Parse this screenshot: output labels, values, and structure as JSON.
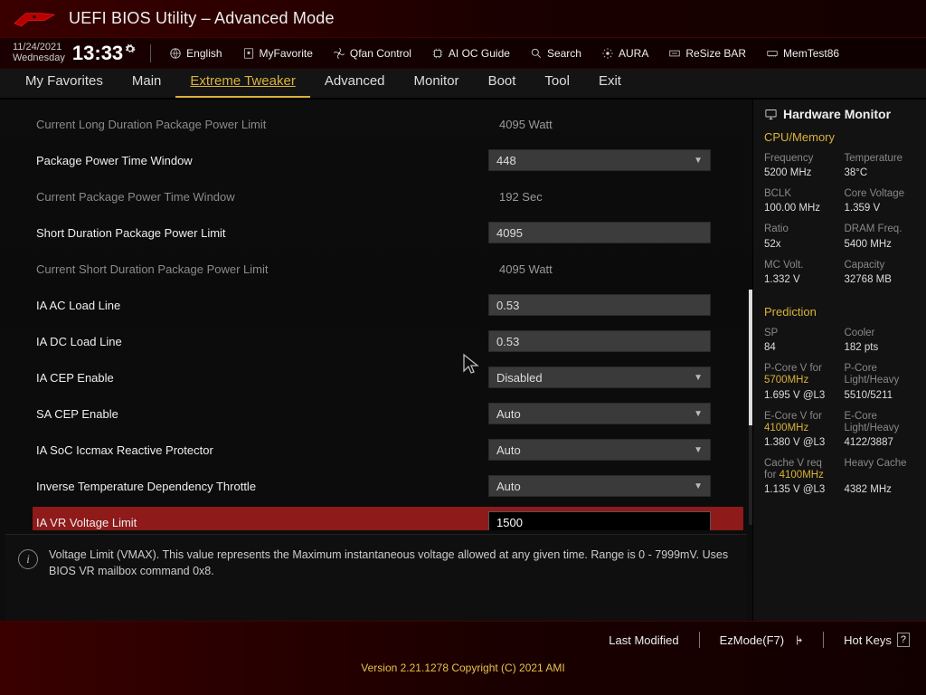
{
  "title": "UEFI BIOS Utility – Advanced Mode",
  "datetime": {
    "date": "11/24/2021",
    "weekday": "Wednesday",
    "clock": "13:33"
  },
  "util_links": {
    "language": "English",
    "myfavorite": "MyFavorite",
    "qfan": "Qfan Control",
    "aioc": "AI OC Guide",
    "search": "Search",
    "aura": "AURA",
    "resizebar": "ReSize BAR",
    "memtest": "MemTest86"
  },
  "tabs": {
    "myfav": "My Favorites",
    "main": "Main",
    "extreme": "Extreme Tweaker",
    "advanced": "Advanced",
    "monitor": "Monitor",
    "boot": "Boot",
    "tool": "Tool",
    "exit": "Exit"
  },
  "settings": [
    {
      "type": "ro",
      "label": "Current Long Duration Package Power Limit",
      "value": "4095 Watt"
    },
    {
      "type": "dd",
      "label": "Package Power Time Window",
      "value": "448"
    },
    {
      "type": "ro",
      "label": "Current Package Power Time Window",
      "value": "192 Sec"
    },
    {
      "type": "tx",
      "label": "Short Duration Package Power Limit",
      "value": "4095"
    },
    {
      "type": "ro",
      "label": "Current Short Duration Package Power Limit",
      "value": "4095 Watt"
    },
    {
      "type": "tx",
      "label": "IA AC Load Line",
      "value": "0.53"
    },
    {
      "type": "tx",
      "label": "IA DC Load Line",
      "value": "0.53"
    },
    {
      "type": "dd",
      "label": "IA CEP Enable",
      "value": "Disabled"
    },
    {
      "type": "dd",
      "label": "SA CEP Enable",
      "value": "Auto"
    },
    {
      "type": "dd",
      "label": "IA SoC Iccmax Reactive Protector",
      "value": "Auto"
    },
    {
      "type": "dd",
      "label": "Inverse Temperature Dependency Throttle",
      "value": "Auto"
    },
    {
      "type": "tx",
      "label": "IA VR Voltage Limit",
      "value": "1500",
      "selected": true
    }
  ],
  "help_text": "Voltage Limit (VMAX). This value represents the Maximum instantaneous voltage allowed at any given time. Range is 0 - 7999mV. Uses BIOS VR mailbox command 0x8.",
  "hwmon": {
    "title": "Hardware Monitor",
    "sec_cpu": "CPU/Memory",
    "freq_k": "Frequency",
    "freq_v": "5200 MHz",
    "temp_k": "Temperature",
    "temp_v": "38°C",
    "bclk_k": "BCLK",
    "bclk_v": "100.00 MHz",
    "corev_k": "Core Voltage",
    "corev_v": "1.359 V",
    "ratio_k": "Ratio",
    "ratio_v": "52x",
    "dram_k": "DRAM Freq.",
    "dram_v": "5400 MHz",
    "mcv_k": "MC Volt.",
    "mcv_v": "1.332 V",
    "cap_k": "Capacity",
    "cap_v": "32768 MB",
    "sec_pred": "Prediction",
    "sp_k": "SP",
    "sp_v": "84",
    "cool_k": "Cooler",
    "cool_v": "182 pts",
    "pcv_k1": "P-Core V for",
    "pcv_k2": "5700MHz",
    "pcv_v": "1.695 V @L3",
    "pclh_k1": "P-Core",
    "pclh_k2": "Light/Heavy",
    "pclh_v": "5510/5211",
    "ecv_k1": "E-Core V for",
    "ecv_k2": "4100MHz",
    "ecv_v": "1.380 V @L3",
    "eclh_k1": "E-Core",
    "eclh_k2": "Light/Heavy",
    "eclh_v": "4122/3887",
    "cvr_k1": "Cache V req",
    "cvr_k2": "for",
    "cvr_k3": "4100MHz",
    "cvr_v": "1.135 V @L3",
    "hc_k": "Heavy Cache",
    "hc_v": "4382 MHz"
  },
  "bottom": {
    "lastmod": "Last Modified",
    "ezmode": "EzMode(F7)",
    "hotkeys": "Hot Keys",
    "copyright": "Version 2.21.1278 Copyright (C) 2021 AMI"
  }
}
